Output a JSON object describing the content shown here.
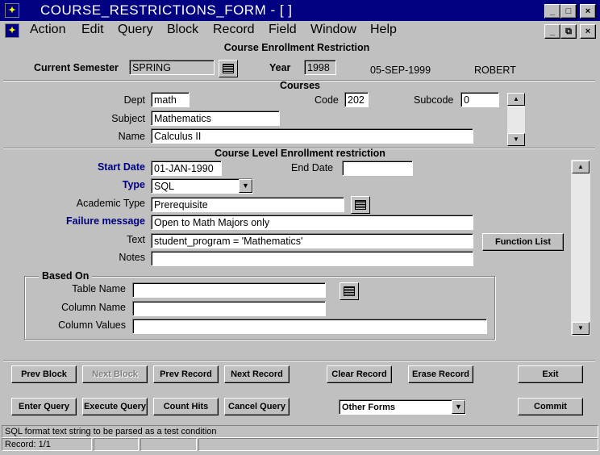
{
  "window": {
    "title": "COURSE_RESTRICTIONS_FORM - [ ]",
    "icon": "oracle-forms-icon",
    "controls": {
      "minimize": "_",
      "maximize": "□",
      "close": "×",
      "restore": "⧉"
    }
  },
  "menu": [
    "Action",
    "Edit",
    "Query",
    "Block",
    "Record",
    "Field",
    "Window",
    "Help"
  ],
  "form_title": "Course Enrollment Restriction",
  "header": {
    "semester_label": "Current Semester",
    "semester_value": "SPRING",
    "year_label": "Year",
    "year_value": "1998",
    "date": "05-SEP-1999",
    "user": "ROBERT"
  },
  "courses": {
    "section_title": "Courses",
    "dept_label": "Dept",
    "dept_value": "math",
    "code_label": "Code",
    "code_value": "202",
    "subcode_label": "Subcode",
    "subcode_value": "0",
    "subject_label": "Subject",
    "subject_value": "Mathematics",
    "name_label": "Name",
    "name_value": "Calculus II"
  },
  "restriction": {
    "section_title": "Course Level Enrollment restriction",
    "start_date_label": "Start Date",
    "start_date_value": "01-JAN-1990",
    "end_date_label": "End Date",
    "end_date_value": "",
    "type_label": "Type",
    "type_value": "SQL",
    "academic_type_label": "Academic Type",
    "academic_type_value": "Prerequisite",
    "failure_label": "Failure message",
    "failure_value": "Open to Math Majors only",
    "text_label": "Text",
    "text_value": "student_program = 'Mathematics'",
    "function_list_button": "Function List",
    "notes_label": "Notes",
    "notes_value": ""
  },
  "based_on": {
    "group_title": "Based On",
    "table_name_label": "Table Name",
    "table_name_value": "",
    "column_name_label": "Column Name",
    "column_name_value": "",
    "column_values_label": "Column Values",
    "column_values_value": ""
  },
  "buttons": {
    "prev_block": "Prev Block",
    "next_block": "Next Block",
    "prev_record": "Prev Record",
    "next_record": "Next Record",
    "clear_record": "Clear Record",
    "erase_record": "Erase Record",
    "exit": "Exit",
    "enter_query": "Enter Query",
    "execute_query": "Execute Query",
    "count_hits": "Count Hits",
    "cancel_query": "Cancel Query",
    "other_forms": "Other Forms",
    "commit": "Commit"
  },
  "status": {
    "message": "SQL format text string to be parsed as a test condition",
    "record": "Record: 1/1"
  }
}
